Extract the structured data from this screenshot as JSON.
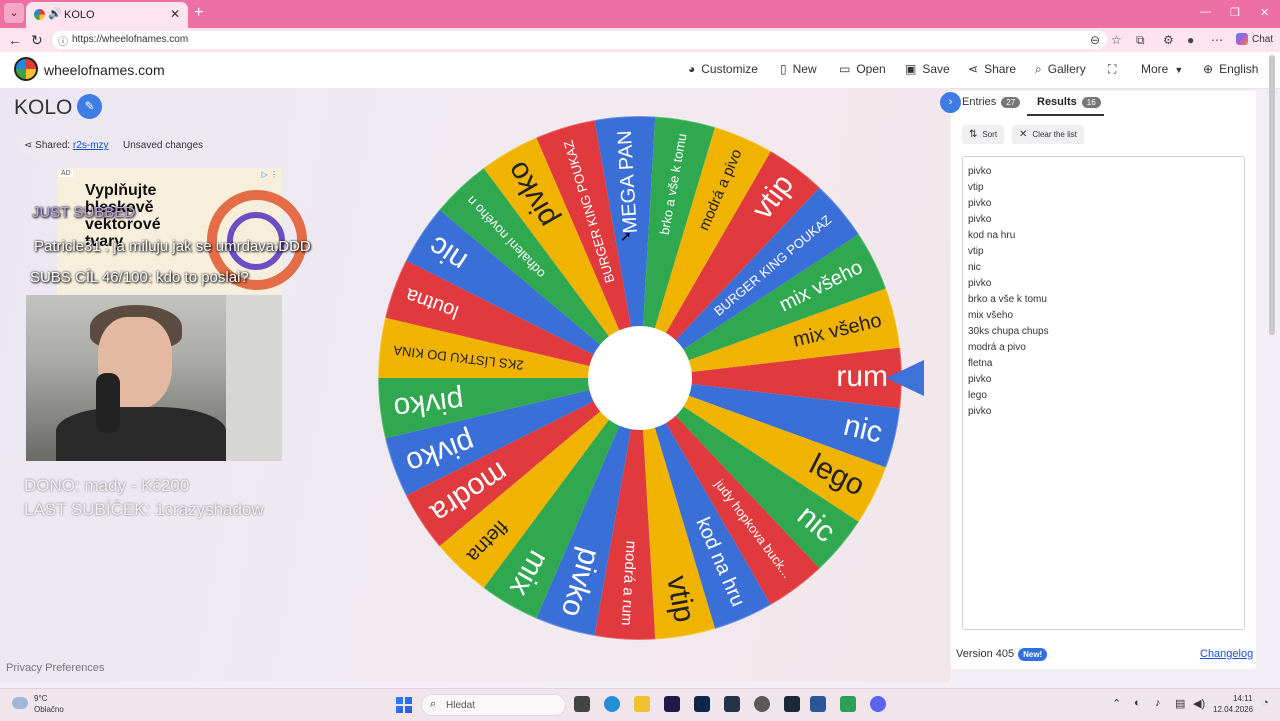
{
  "browser": {
    "tab_title": "KOLO",
    "url": "https://wheelofnames.com",
    "chat_label": "Chat"
  },
  "header": {
    "site_name": "wheelofnames.com",
    "menu": {
      "customize": "Customize",
      "new": "New",
      "open": "Open",
      "save": "Save",
      "share": "Share",
      "gallery": "Gallery",
      "more": "More",
      "language": "English"
    }
  },
  "wheel_title": "KOLO",
  "shared": {
    "label": "Shared:",
    "code": "r2s-mzy"
  },
  "unsaved": "Unsaved changes",
  "ad": {
    "badge": "AD",
    "text": "Vyplňujte bleskově vektorové tvary"
  },
  "overlay": {
    "chat1": "Patricle31 : ja miluju jak se umrdava:DDD",
    "subs": "SUBS CÍL 46/100: kdo to poslal?",
    "justsubbed": "JUST SUBBED",
    "dono": "DONO: mady - Kč200",
    "last_sub": "LAST SUBÍČEK: 1crazyshadow"
  },
  "wheel": {
    "segments": [
      {
        "label": "rum",
        "color": "#e03a3e"
      },
      {
        "label": "nic",
        "color": "#3b6fd8"
      },
      {
        "label": "lego",
        "color": "#f0b400"
      },
      {
        "label": "nic",
        "color": "#2fa84f"
      },
      {
        "label": "judy hopkova buck...",
        "color": "#e03a3e"
      },
      {
        "label": "kod na hru",
        "color": "#3b6fd8"
      },
      {
        "label": "vtip",
        "color": "#f0b400"
      },
      {
        "label": "modrá a rum",
        "color": "#e03a3e"
      },
      {
        "label": "pivko",
        "color": "#3b6fd8"
      },
      {
        "label": "mix",
        "color": "#2fa84f"
      },
      {
        "label": "fletna",
        "color": "#f0b400"
      },
      {
        "label": "modra",
        "color": "#e03a3e"
      },
      {
        "label": "pivko",
        "color": "#3b6fd8"
      },
      {
        "label": "pivko",
        "color": "#2fa84f"
      },
      {
        "label": "2KS LÍSTKU DO KINA",
        "color": "#f0b400"
      },
      {
        "label": "loutna",
        "color": "#e03a3e"
      },
      {
        "label": "nic",
        "color": "#3b6fd8"
      },
      {
        "label": "odhalení nového n",
        "color": "#2fa84f"
      },
      {
        "label": "pivko",
        "color": "#f0b400"
      },
      {
        "label": "BURGER KING POUKAZ",
        "color": "#e03a3e"
      },
      {
        "label": "MEGA PAN",
        "color": "#3b6fd8"
      },
      {
        "label": "brko a vše k tomu",
        "color": "#2fa84f"
      },
      {
        "label": "modrá a pivo",
        "color": "#f0b400"
      },
      {
        "label": "vtip",
        "color": "#e03a3e"
      },
      {
        "label": "BURGER KING POUKAZ",
        "color": "#3b6fd8"
      },
      {
        "label": "mix všeho",
        "color": "#2fa84f"
      },
      {
        "label": "mix všeho",
        "color": "#f0b400"
      }
    ]
  },
  "panel": {
    "entries_label": "Entries",
    "entries_count": "27",
    "results_label": "Results",
    "results_count": "16",
    "sort_label": "Sort",
    "clear_label": "Clear the list",
    "results": [
      "pivko",
      "vtip",
      "pivko",
      "pivko",
      "kod na hru",
      "vtip",
      "nic",
      "pivko",
      "brko a vše k tomu",
      "mix všeho",
      "30ks chupa chups",
      "modrá a pivo",
      "fletna",
      "pivko",
      "lego",
      "pivko"
    ],
    "version": "Version 405",
    "new_badge": "New!",
    "changelog": "Changelog"
  },
  "privacy": "Privacy Preferences",
  "taskbar": {
    "temp": "9°C",
    "condition": "Oblačno",
    "search_placeholder": "Hledat",
    "time": "14:11",
    "date": "12.04.2026"
  }
}
